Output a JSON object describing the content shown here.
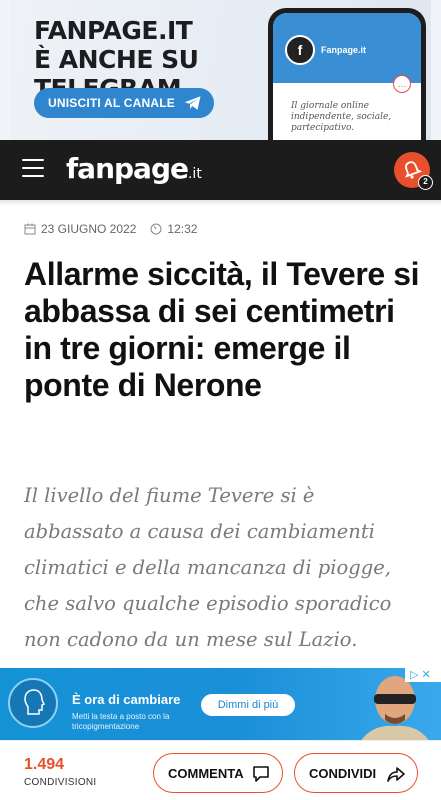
{
  "promo": {
    "title_line1": "FANPAGE.IT",
    "title_line2": "È ANCHE SU TELEGRAM",
    "button_label": "UNISCITI AL CANALE",
    "phone_channel_name": "Fanpage.it",
    "phone_tagline": "Il giornale online indipendente, sociale, partecipativo."
  },
  "header": {
    "logo_text": "fanpage",
    "logo_tld": ".it",
    "notifications_count": "2",
    "accent_color": "#e8502d"
  },
  "article": {
    "date": "23 GIUGNO 2022",
    "time": "12:32",
    "headline": "Allarme siccità, il Tevere si abbassa di sei centimetri in tre giorni: emerge il ponte di Nerone",
    "subtitle": "Il livello del fiume Tevere si è abbassato a causa dei cambiamenti climatici e della mancanza di piogge, che salvo qualche episodio sporadico non cadono da un mese sul Lazio."
  },
  "ad": {
    "title": "È ora di cambiare",
    "text": "Metti la testa a posto con la tricopigmentazione",
    "cta": "Dimmi di più",
    "choices_label": "▷ ✕"
  },
  "footer": {
    "shares_count": "1.494",
    "shares_label": "CONDIVISIONI",
    "comment_label": "COMMENTA",
    "share_label": "CONDIVIDI"
  }
}
